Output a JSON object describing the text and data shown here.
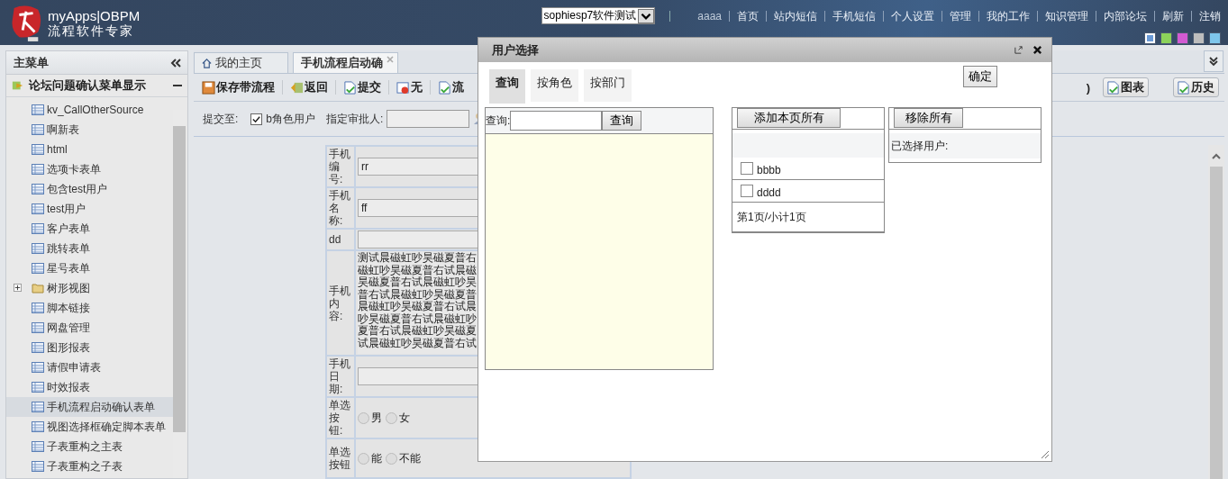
{
  "header": {
    "logo_title": "myApps|OBPM",
    "logo_subtitle": "流程软件专家",
    "app_select": "sophiesp7软件测试",
    "nav": [
      "aaaa",
      "首页",
      "站内短信",
      "手机短信",
      "个人设置",
      "管理",
      "我的工作",
      "知识管理",
      "内部论坛",
      "刷新",
      "注销"
    ],
    "themes": [
      {
        "color": "#6a9ad6",
        "selected": true
      },
      {
        "color": "#8cd25a",
        "selected": false
      },
      {
        "color": "#d25ad2",
        "selected": false
      },
      {
        "color": "#bdbdbd",
        "selected": false
      },
      {
        "color": "#7ec6ec",
        "selected": false
      }
    ]
  },
  "sidebar": {
    "title": "主菜单",
    "section": "论坛问题确认菜单显示",
    "items": [
      {
        "label": "kv_CallOtherSource",
        "kind": "form",
        "selected": false
      },
      {
        "label": "啊新表",
        "kind": "form",
        "selected": false
      },
      {
        "label": "html",
        "kind": "form",
        "selected": false
      },
      {
        "label": "选项卡表单",
        "kind": "form",
        "selected": false
      },
      {
        "label": "包含test用户",
        "kind": "form",
        "selected": false
      },
      {
        "label": "test用户",
        "kind": "form",
        "selected": false
      },
      {
        "label": "客户表单",
        "kind": "form",
        "selected": false
      },
      {
        "label": "跳转表单",
        "kind": "form",
        "selected": false
      },
      {
        "label": "星号表单",
        "kind": "form",
        "selected": false
      },
      {
        "label": "树形视图",
        "kind": "folder",
        "selected": false,
        "expanded": false
      },
      {
        "label": "脚本链接",
        "kind": "form",
        "selected": false
      },
      {
        "label": "网盘管理",
        "kind": "form",
        "selected": false
      },
      {
        "label": "图形报表",
        "kind": "form",
        "selected": false
      },
      {
        "label": "请假申请表",
        "kind": "form",
        "selected": false
      },
      {
        "label": "时效报表",
        "kind": "form",
        "selected": false
      },
      {
        "label": "手机流程启动确认表单",
        "kind": "form",
        "selected": true
      },
      {
        "label": "视图选择框确定脚本表单",
        "kind": "form",
        "selected": false
      },
      {
        "label": "子表重构之主表",
        "kind": "form",
        "selected": false
      },
      {
        "label": "子表重构之子表",
        "kind": "form",
        "selected": false
      }
    ]
  },
  "tabs": [
    {
      "label": "我的主页",
      "selected": false,
      "closable": false
    },
    {
      "label": "手机流程启动确",
      "selected": true,
      "closable": true
    }
  ],
  "toolbar": [
    {
      "label": "保存带流程",
      "kind": "save"
    },
    {
      "label": "返回",
      "kind": "back"
    },
    {
      "label": "提交",
      "kind": "doc"
    },
    {
      "label": "无",
      "kind": "none"
    },
    {
      "label": "流",
      "kind": "doc"
    }
  ],
  "toolbar_fragment": ")",
  "toolbar_right": [
    {
      "label": "图表",
      "kind": "doc"
    },
    {
      "label": "历史",
      "kind": "doc"
    }
  ],
  "submit": {
    "label": "提交至:",
    "role_checked": true,
    "role_label": "b角色用户",
    "approver_label": "指定审批人:"
  },
  "form": {
    "rows": [
      {
        "label": "手机编号:",
        "kind": "text",
        "value": "rr"
      },
      {
        "label": "手机名称:",
        "kind": "text",
        "value": "ff"
      },
      {
        "label": "dd",
        "kind": "text"
      },
      {
        "label": "手机内容:",
        "kind": "textarea",
        "value": "测试晨磁虹吵昊磁夏普右磁虹吵昊磁夏普右试晨磁昊磁夏普右试晨磁虹吵昊普右试晨磁虹吵昊磁夏普晨磁虹吵昊磁夏普右试晨吵昊磁夏普右试晨磁虹吵夏普右试晨磁虹吵昊磁夏试晨磁虹吵昊磁夏普右试"
      },
      {
        "label": "手机日期:",
        "kind": "text"
      },
      {
        "label": "单选按钮:",
        "kind": "radio",
        "options": [
          {
            "label": "男",
            "selected": false
          },
          {
            "label": "女",
            "selected": false
          }
        ]
      },
      {
        "label": "单选按钮",
        "kind": "radio",
        "options": [
          {
            "label": "能",
            "selected": false
          },
          {
            "label": "不能",
            "selected": false
          }
        ]
      }
    ]
  },
  "dialog": {
    "title": "用户选择",
    "tabs": [
      {
        "label": "查询",
        "selected": true
      },
      {
        "label": "按角色",
        "selected": false
      },
      {
        "label": "按部门",
        "selected": false
      }
    ],
    "confirm": "确定",
    "search_label": "查询:",
    "search_button": "查询",
    "add_all": "添加本页所有",
    "users": [
      {
        "name": "bbbb",
        "checked": false
      },
      {
        "name": "dddd",
        "checked": false
      }
    ],
    "pager": "第1页/小计1页",
    "remove_all": "移除所有",
    "selected_label": "已选择用户:"
  }
}
